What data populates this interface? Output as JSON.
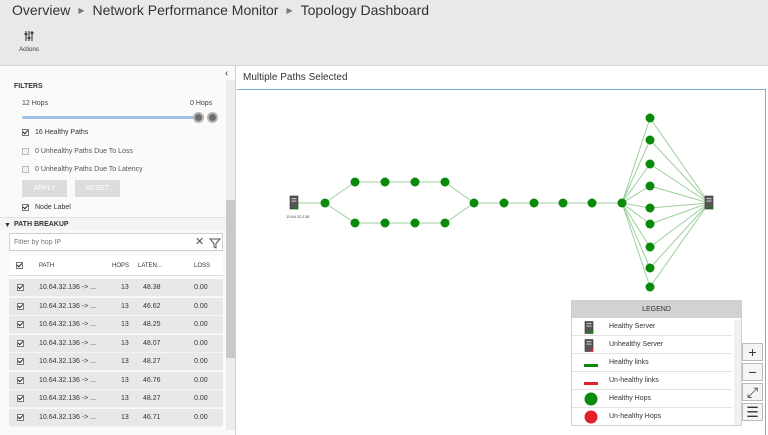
{
  "breadcrumb": [
    "Overview",
    "Network Performance Monitor",
    "Topology Dashboard"
  ],
  "toolbar": {
    "actions_label": "Actions",
    "actions_icon": "sliders-icon"
  },
  "filters": {
    "title": "FILTERS",
    "hops_min_label": "12 Hops",
    "hops_max_label": "0 Hops",
    "options": [
      {
        "label": "16 Healthy Paths",
        "checked": true
      },
      {
        "label": "0 Unhealthy Paths Due To Loss",
        "checked": false
      },
      {
        "label": "0 Unhealthy Paths Due To Latency",
        "checked": false
      }
    ],
    "apply_label": "APPLY",
    "reset_label": "RESET",
    "node_label": "Node Label"
  },
  "path_breakup": {
    "title": "PATH BREAKUP",
    "filter_placeholder": "Filter by hop IP",
    "columns": [
      "PATH",
      "HOPS",
      "LATEN...",
      "LOSS"
    ],
    "rows": [
      {
        "path": "10.64.32.136 -> ...",
        "hops": "13",
        "latency": "48.38",
        "loss": "0.00"
      },
      {
        "path": "10.64.32.136 -> ...",
        "hops": "13",
        "latency": "46.62",
        "loss": "0.00"
      },
      {
        "path": "10.64.32.136 -> ...",
        "hops": "13",
        "latency": "48.25",
        "loss": "0.00"
      },
      {
        "path": "10.64.32.136 -> ...",
        "hops": "13",
        "latency": "48.07",
        "loss": "0.00"
      },
      {
        "path": "10.64.32.136 -> ...",
        "hops": "13",
        "latency": "48.27",
        "loss": "0.00"
      },
      {
        "path": "10.64.32.136 -> ...",
        "hops": "13",
        "latency": "46.76",
        "loss": "0.00"
      },
      {
        "path": "10.64.32.136 -> ...",
        "hops": "13",
        "latency": "48.27",
        "loss": "0.00"
      },
      {
        "path": "10.64.32.136 -> ...",
        "hops": "13",
        "latency": "46.71",
        "loss": "0.00"
      }
    ]
  },
  "main": {
    "title": "Multiple Paths Selected"
  },
  "topology": {
    "source_label": "10.64.32.136",
    "healthy_color": "#0a8a0a",
    "link_color": "#9ccf9c"
  },
  "legend": {
    "title": "LEGEND",
    "items": [
      {
        "label": "Healthy Server",
        "icon": "server-icon"
      },
      {
        "label": "Unhealthy Server",
        "icon": "server-alert-icon"
      },
      {
        "label": "Healthy links",
        "icon": "healthy-link-icon"
      },
      {
        "label": "Un-healthy links",
        "icon": "unhealthy-link-icon"
      },
      {
        "label": "Healthy Hops",
        "icon": "healthy-hop-icon"
      },
      {
        "label": "Un-healthy Hops",
        "icon": "unhealthy-hop-icon"
      }
    ],
    "colors": {
      "healthy": "#0a8a0a",
      "unhealthy": "#e0202a"
    }
  },
  "zoom_controls": [
    {
      "symbol": "+",
      "icon": "zoom-in-icon"
    },
    {
      "symbol": "−",
      "icon": "zoom-out-icon"
    },
    {
      "symbol": "⤢",
      "icon": "fit-to-screen-icon"
    },
    {
      "symbol": "☰",
      "icon": "list-icon"
    }
  ]
}
